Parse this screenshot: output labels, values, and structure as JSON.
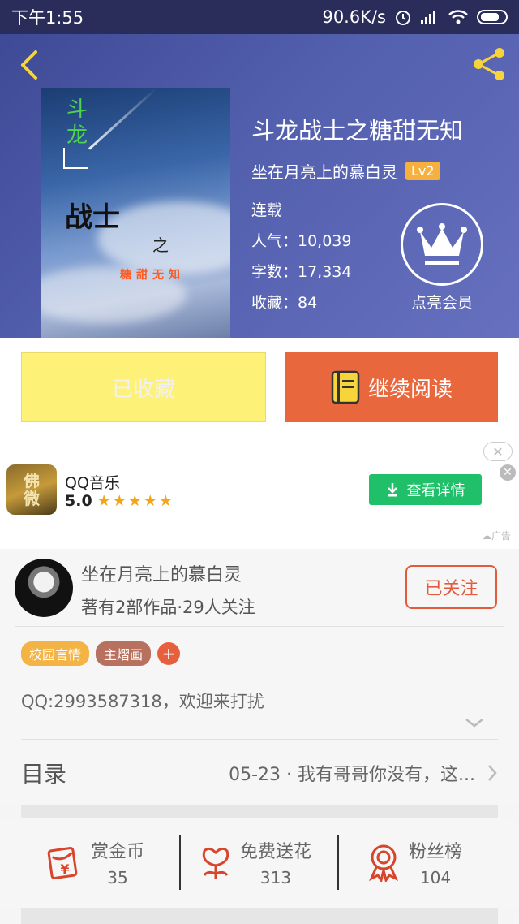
{
  "status_bar": {
    "time": "下午1:55",
    "network_speed": "90.6K/s"
  },
  "book": {
    "title": "斗龙战士之糖甜无知",
    "author": "坐在月亮上的慕白灵",
    "level": "Lv2",
    "status": "连载",
    "popularity": "人气：10,039",
    "word_count": "字数：17,334",
    "favorites": "收藏：84",
    "vip_label": "点亮会员",
    "cover_text": {
      "line1": "斗",
      "line2": "龙",
      "line3": "战士",
      "line4": "之",
      "line5": "糖甜无知"
    }
  },
  "actions": {
    "favorited_label": "已收藏",
    "continue_label": "继续阅读"
  },
  "ad": {
    "app_icon_text": "佛\n微",
    "app_name": "QQ音乐",
    "rating": "5.0",
    "stars": "★★★★★",
    "button_label": "查看详情",
    "ad_tag": "广告"
  },
  "author_section": {
    "name": "坐在月亮上的慕白灵",
    "stats": "著有2部作品·29人关注",
    "follow_label": "已关注",
    "tags": [
      "校园言情",
      "主熠画"
    ],
    "intro": "QQ:2993587318，欢迎来打扰"
  },
  "catalog": {
    "label": "目录",
    "latest": "05-23 · 我有哥哥你没有，这..."
  },
  "stats": [
    {
      "label": "赏金币",
      "value": "35"
    },
    {
      "label": "免费送花",
      "value": "313"
    },
    {
      "label": "粉丝榜",
      "value": "104"
    }
  ],
  "colors": {
    "accent_orange": "#e8673d",
    "favorite_yellow": "#fdf277",
    "level_badge": "#f6b03d",
    "ad_green": "#1fc069",
    "stat_icon_red": "#d8452b"
  }
}
